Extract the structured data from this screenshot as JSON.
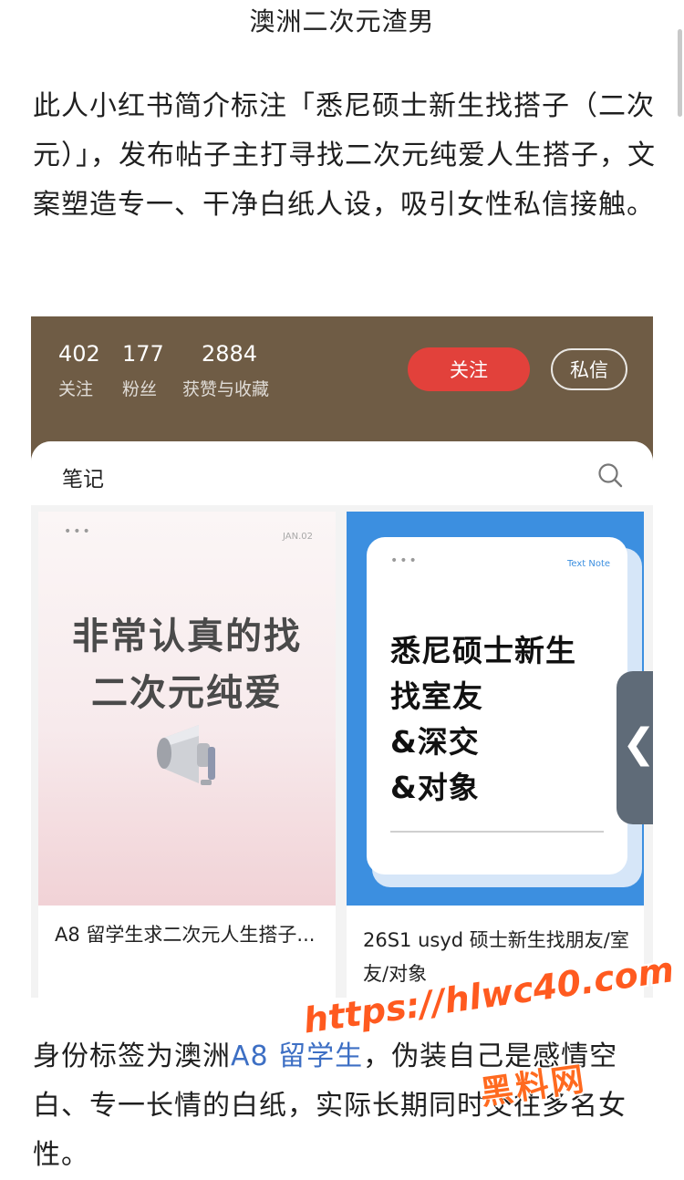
{
  "page": {
    "title": "澳洲二次元渣男",
    "intro": "此人小红书简介标注「悉尼硕士新生找搭子（二次元）」，发布帖子主打寻找二次元纯爱人生搭子，文案塑造专一、干净白纸人设，吸引女性私信接触。",
    "body_prefix": "身份标签为澳洲",
    "body_tag": "A8 留学生",
    "body_suffix": "，伪装自己是感情空白、专一长情的白纸，实际长期同时交往多名女性。"
  },
  "profile": {
    "stats": [
      {
        "value": "402",
        "label": "关注"
      },
      {
        "value": "177",
        "label": "粉丝"
      },
      {
        "value": "2884",
        "label": "获赞与收藏"
      }
    ],
    "follow_label": "关注",
    "dm_label": "私信",
    "bar_color": "#6f5c45",
    "follow_color": "#e2413b"
  },
  "notes": {
    "section_label": "笔记",
    "search_icon": "search-icon",
    "cards": [
      {
        "cover_corner": "JAN.02",
        "cover_lines": [
          "非常认真的找",
          "二次元纯爱"
        ],
        "cover_icon": "megaphone-icon",
        "title": "A8 留学生求二次元人生搭子..."
      },
      {
        "cover_corner": "Text Note",
        "cover_lines": [
          "悉尼硕士新生",
          "找室友",
          "&深交",
          "&对象"
        ],
        "title": "26S1 usyd 硕士新生找朋友/室友/对象"
      }
    ]
  },
  "side_handle": {
    "glyph": "❮"
  },
  "watermark": {
    "url": "https://hlwc40.com",
    "name": "黑料网"
  }
}
